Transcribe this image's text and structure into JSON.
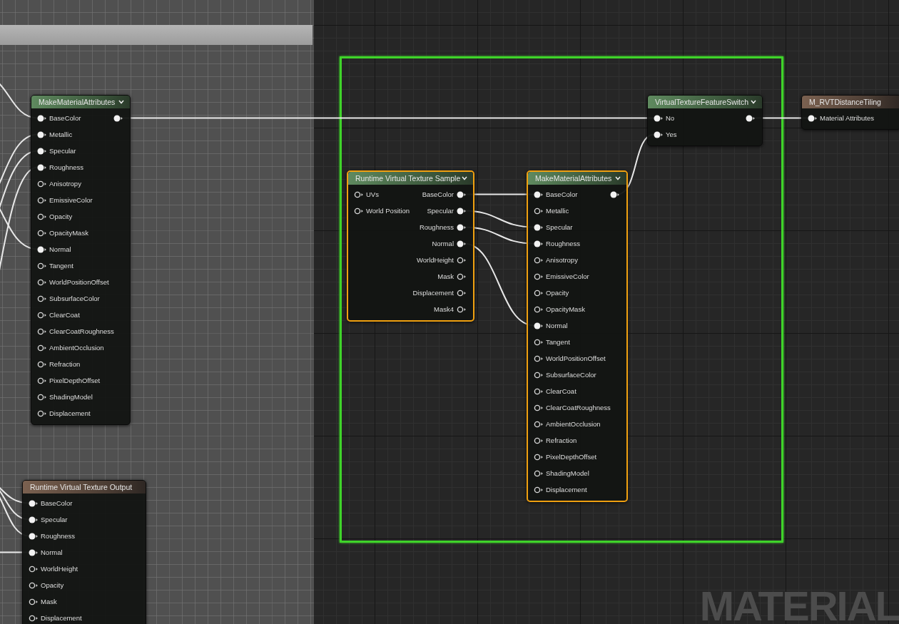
{
  "comments": [
    {
      "selected": false
    },
    {
      "selected": true
    }
  ],
  "nodes": [
    {
      "title": "MakeMaterialAttributes",
      "kind": "expression",
      "selected": false,
      "inputs": [
        {
          "label": "BaseColor",
          "connected": true
        },
        {
          "label": "Metallic",
          "connected": true
        },
        {
          "label": "Specular",
          "connected": true
        },
        {
          "label": "Roughness",
          "connected": true
        },
        {
          "label": "Anisotropy",
          "connected": false
        },
        {
          "label": "EmissiveColor",
          "connected": false
        },
        {
          "label": "Opacity",
          "connected": false
        },
        {
          "label": "OpacityMask",
          "connected": false
        },
        {
          "label": "Normal",
          "connected": true
        },
        {
          "label": "Tangent",
          "connected": false
        },
        {
          "label": "WorldPositionOffset",
          "connected": false
        },
        {
          "label": "SubsurfaceColor",
          "connected": false
        },
        {
          "label": "ClearCoat",
          "connected": false
        },
        {
          "label": "ClearCoatRoughness",
          "connected": false
        },
        {
          "label": "AmbientOcclusion",
          "connected": false
        },
        {
          "label": "Refraction",
          "connected": false
        },
        {
          "label": "PixelDepthOffset",
          "connected": false
        },
        {
          "label": "ShadingModel",
          "connected": false
        },
        {
          "label": "Displacement",
          "connected": false
        }
      ],
      "outputs": [
        {
          "connected": true
        }
      ]
    },
    {
      "title": "Runtime Virtual Texture Output",
      "kind": "result",
      "selected": false,
      "inputs": [
        {
          "label": "BaseColor",
          "connected": true
        },
        {
          "label": "Specular",
          "connected": true
        },
        {
          "label": "Roughness",
          "connected": true
        },
        {
          "label": "Normal",
          "connected": true
        },
        {
          "label": "WorldHeight",
          "connected": false
        },
        {
          "label": "Opacity",
          "connected": false
        },
        {
          "label": "Mask",
          "connected": false
        },
        {
          "label": "Displacement",
          "connected": false
        }
      ]
    },
    {
      "title": "Runtime Virtual Texture Sample",
      "kind": "expression",
      "selected": true,
      "inputs": [
        {
          "label": "UVs",
          "connected": false
        },
        {
          "label": "World Position",
          "connected": false
        }
      ],
      "outputs": [
        {
          "label": "BaseColor",
          "connected": true
        },
        {
          "label": "Specular",
          "connected": true
        },
        {
          "label": "Roughness",
          "connected": true
        },
        {
          "label": "Normal",
          "connected": true
        },
        {
          "label": "WorldHeight",
          "connected": false
        },
        {
          "label": "Mask",
          "connected": false
        },
        {
          "label": "Displacement",
          "connected": false
        },
        {
          "label": "Mask4",
          "connected": false
        }
      ]
    },
    {
      "title": "MakeMaterialAttributes",
      "kind": "expression",
      "selected": true,
      "inputs": [
        {
          "label": "BaseColor",
          "connected": true
        },
        {
          "label": "Metallic",
          "connected": false
        },
        {
          "label": "Specular",
          "connected": true
        },
        {
          "label": "Roughness",
          "connected": true
        },
        {
          "label": "Anisotropy",
          "connected": false
        },
        {
          "label": "EmissiveColor",
          "connected": false
        },
        {
          "label": "Opacity",
          "connected": false
        },
        {
          "label": "OpacityMask",
          "connected": false
        },
        {
          "label": "Normal",
          "connected": true
        },
        {
          "label": "Tangent",
          "connected": false
        },
        {
          "label": "WorldPositionOffset",
          "connected": false
        },
        {
          "label": "SubsurfaceColor",
          "connected": false
        },
        {
          "label": "ClearCoat",
          "connected": false
        },
        {
          "label": "ClearCoatRoughness",
          "connected": false
        },
        {
          "label": "AmbientOcclusion",
          "connected": false
        },
        {
          "label": "Refraction",
          "connected": false
        },
        {
          "label": "PixelDepthOffset",
          "connected": false
        },
        {
          "label": "ShadingModel",
          "connected": false
        },
        {
          "label": "Displacement",
          "connected": false
        }
      ],
      "outputs": [
        {
          "connected": true
        }
      ]
    },
    {
      "title": "VirtualTextureFeatureSwitch",
      "kind": "expression",
      "selected": false,
      "inputs": [
        {
          "label": "No",
          "connected": true
        },
        {
          "label": "Yes",
          "connected": true
        }
      ],
      "outputs": [
        {
          "connected": true
        }
      ]
    },
    {
      "title": "M_RVTDistanceTiling",
      "kind": "result",
      "selected": false,
      "inputs": [
        {
          "label": "Material Attributes",
          "connected": true
        }
      ]
    }
  ],
  "graph_label": "MATERIAL"
}
